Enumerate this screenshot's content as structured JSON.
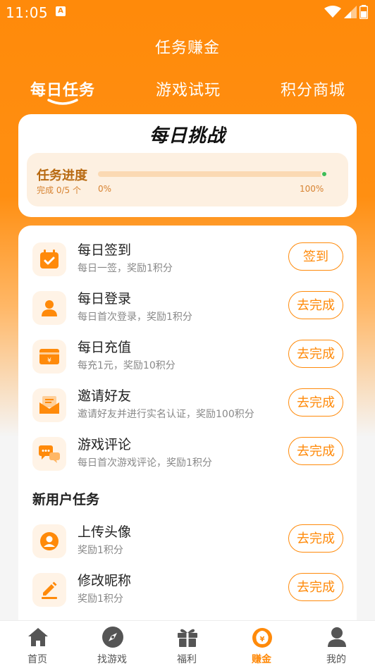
{
  "status_bar": {
    "time": "11:05",
    "notification_badge": "A"
  },
  "header": {
    "title": "任务赚金"
  },
  "tabs": [
    {
      "label": "每日任务",
      "active": true
    },
    {
      "label": "游戏试玩",
      "active": false
    },
    {
      "label": "积分商城",
      "active": false
    }
  ],
  "challenge": {
    "title": "每日挑战",
    "progress_label": "任务进度",
    "completed_prefix": "完成",
    "completed_count": "0/5",
    "completed_unit": "个",
    "progress_min": "0%",
    "progress_max": "100%",
    "progress_value": 0
  },
  "daily_tasks": [
    {
      "title": "每日签到",
      "desc": "每日一签，奖励1积分",
      "button": "签到",
      "icon": "calendar-check-icon"
    },
    {
      "title": "每日登录",
      "desc": "每日首次登录，奖励1积分",
      "button": "去完成",
      "icon": "user-icon"
    },
    {
      "title": "每日充值",
      "desc": "每充1元，奖励10积分",
      "button": "去完成",
      "icon": "wallet-yen-icon"
    },
    {
      "title": "邀请好友",
      "desc": "邀请好友并进行实名认证，奖励100积分",
      "button": "去完成",
      "icon": "envelope-icon"
    },
    {
      "title": "游戏评论",
      "desc": "每日首次游戏评论，奖励1积分",
      "button": "去完成",
      "icon": "chat-bubbles-icon"
    }
  ],
  "new_user_section": {
    "title": "新用户任务"
  },
  "new_user_tasks": [
    {
      "title": "上传头像",
      "desc": "奖励1积分",
      "button": "去完成",
      "icon": "avatar-circle-icon"
    },
    {
      "title": "修改昵称",
      "desc": "奖励1积分",
      "button": "去完成",
      "icon": "pencil-icon"
    }
  ],
  "bottom_nav": [
    {
      "label": "首页",
      "icon": "home-icon",
      "active": false
    },
    {
      "label": "找游戏",
      "icon": "compass-icon",
      "active": false
    },
    {
      "label": "福利",
      "icon": "gift-icon",
      "active": false
    },
    {
      "label": "赚金",
      "icon": "money-bag-icon",
      "active": true
    },
    {
      "label": "我的",
      "icon": "person-icon",
      "active": false
    }
  ],
  "colors": {
    "accent": "#ff8a0a",
    "progress_dot": "#3dbd58",
    "icon_bg": "#fff3e6"
  }
}
